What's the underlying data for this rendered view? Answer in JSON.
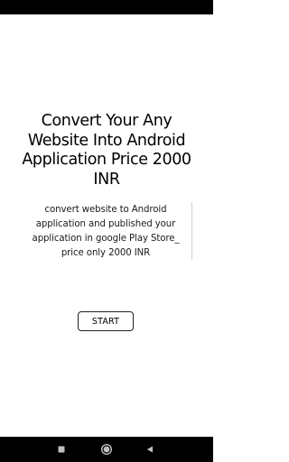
{
  "app": {
    "headline": "Convert Your Any Website Into Android Application Price 2000 INR",
    "description": "convert website to Android application and published your application in google Play Store_ price only 2000 INR",
    "start_label": "START"
  },
  "system_nav": {
    "recents_icon": "square-icon",
    "home_icon": "circle-icon",
    "back_icon": "triangle-left-icon"
  },
  "colors": {
    "background": "#ffffff",
    "system_bars": "#000000",
    "text": "#000000",
    "nav_icons": "#bfbfbf"
  }
}
